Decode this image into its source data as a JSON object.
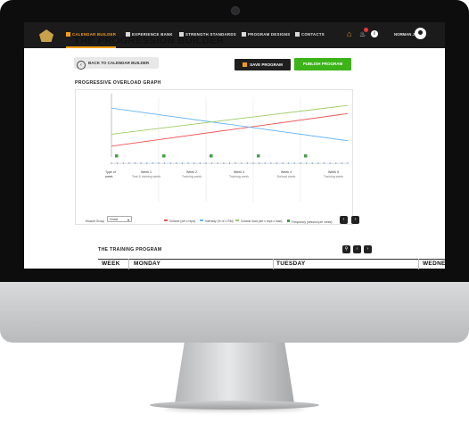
{
  "nav": {
    "items": [
      {
        "label": "CALENDAR BUILDER",
        "active": true,
        "icon": "calendar-icon"
      },
      {
        "label": "EXPERIENCE BANK",
        "active": false,
        "icon": "bank-icon"
      },
      {
        "label": "STRENGTH STANDARDS",
        "active": false,
        "icon": "dumbbell-icon"
      },
      {
        "label": "PROGRAM DESIGNS",
        "active": false,
        "icon": "gear-icon"
      },
      {
        "label": "CONTACTS",
        "active": false,
        "icon": "contacts-icon"
      }
    ],
    "user_name": "NORMAN J.",
    "accent_color": "#f39c12"
  },
  "page": {
    "title": "THE PROGRESSION BUILDER",
    "back_label": "BACK TO CALENDAR BUILDER",
    "save_label": "SAVE PROGRAM",
    "publish_label": "PUBLISH PROGRAM",
    "graph_section_title": "PROGRESSIVE OVERLOAD GRAPH",
    "training_section_title": "THE TRAINING PROGRAM"
  },
  "graph": {
    "type_label": "Type of week",
    "weeks": [
      {
        "title": "Week 1",
        "sub": "Test & training week"
      },
      {
        "title": "Week 2",
        "sub": "Training week"
      },
      {
        "title": "Week 3",
        "sub": "Training week"
      },
      {
        "title": "Week 4",
        "sub": "Deload week"
      },
      {
        "title": "Week 5",
        "sub": "Training week"
      }
    ],
    "muscle_group_label": "Muscle Group",
    "muscle_group_value": "Chest",
    "legend": [
      {
        "label": "Volume (set x reps)",
        "color": "#ef5350"
      },
      {
        "label": "Intensity (% of 1 RM)",
        "color": "#64b5f6"
      },
      {
        "label": "Volume load (set x reps x load)",
        "color": "#9ccc65"
      },
      {
        "label": "Frequency (session per week)",
        "color": "#43a047"
      }
    ]
  },
  "chart_data": {
    "type": "line",
    "series": [
      {
        "name": "Volume (set x reps)",
        "color": "#ef5350",
        "values": [
          20,
          80
        ]
      },
      {
        "name": "Intensity (% of 1 RM)",
        "color": "#64b5f6",
        "values": [
          90,
          30
        ]
      },
      {
        "name": "Volume load (set x reps x load)",
        "color": "#9ccc65",
        "values": [
          42,
          95
        ]
      }
    ],
    "x": [
      0,
      1
    ],
    "markers": {
      "name": "Frequency (session per week)",
      "color": "#43a047",
      "positions": [
        0,
        0.2,
        0.4,
        0.6,
        0.8
      ]
    },
    "ylim": [
      0,
      110
    ]
  },
  "training_table": {
    "columns": [
      "WEEK",
      "MONDAY",
      "TUESDAY",
      "WEDNES"
    ]
  }
}
